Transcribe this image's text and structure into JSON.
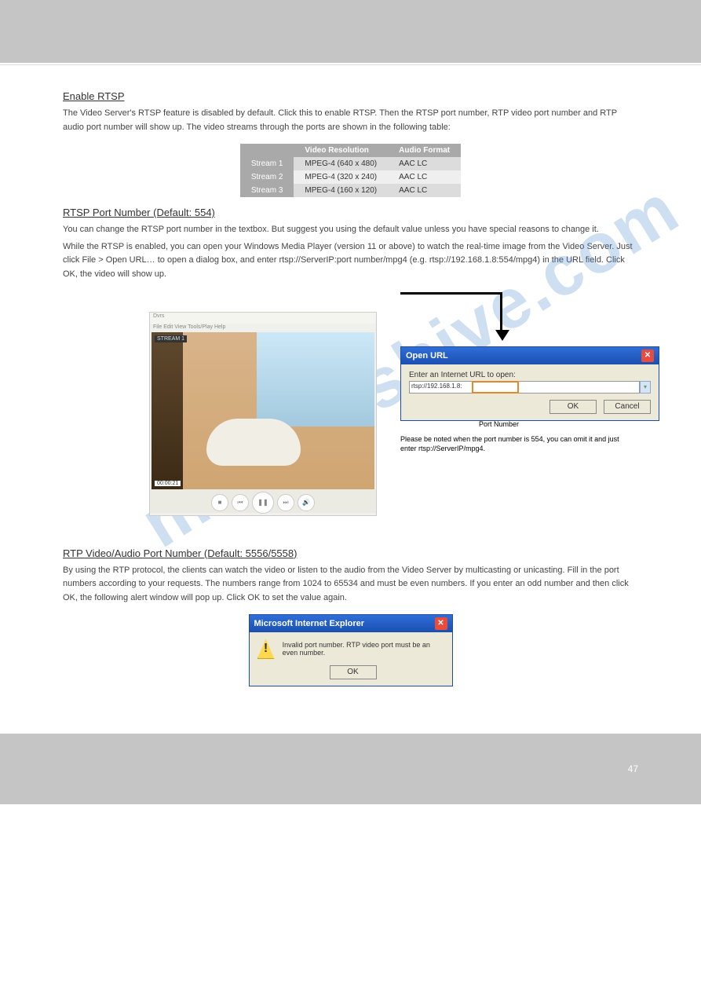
{
  "header": {
    "title": ""
  },
  "section1": {
    "title": "Enable RTSP",
    "para1": "The Video Server's RTSP feature is disabled by default. Click this to enable RTSP. Then the RTSP port number, RTP video port number and RTP audio port number will show up. The video streams through the ports are shown in the following table:",
    "table": {
      "head": [
        "",
        "Video Resolution",
        "Audio Format"
      ],
      "rows": [
        [
          "Stream 1",
          "MPEG-4 (640 x 480)",
          "AAC LC"
        ],
        [
          "Stream 2",
          "MPEG-4 (320 x 240)",
          "AAC LC"
        ],
        [
          "Stream 3",
          "MPEG-4 (160 x 120)",
          "AAC LC"
        ]
      ]
    }
  },
  "section2": {
    "title": "RTSP Port Number (Default: 554)",
    "para1": "You can change the RTSP port number in the textbox. But suggest you using the default value unless you have special reasons to change it.",
    "para2": "While the RTSP is enabled, you can open your Windows Media Player (version 11 or above) to watch the real-time image from the Video Server. Just click File > Open URL… to open a dialog box, and enter rtsp://ServerIP:port number/mpg4 (e.g. rtsp://192.168.1.8:554/mpg4) in the URL field. Click OK, the video will show up.",
    "wmp": {
      "menu": "File  Edit  View  Tools/Play  Help",
      "timestamp": "00:00:21",
      "streamname": "STREAM 1"
    },
    "url_dialog": {
      "title": "Open URL",
      "label": "Enter an Internet URL to open:",
      "prefix": "rtsp://192.168.1.8:",
      "ok": "OK",
      "cancel": "Cancel"
    },
    "annot_port": "Port Number",
    "annot_omit": "Please be noted when the port number is 554, you can omit it and just enter rtsp://ServerIP/mpg4."
  },
  "section3": {
    "title": "RTP Video/Audio Port Number (Default: 5556/5558)",
    "para1": "By using the RTP protocol, the clients can watch the video or listen to the audio from the Video Server by multicasting or unicasting. Fill in the port numbers according to your requests. The numbers range from 1024 to 65534 and must be even numbers. If you enter an odd number and then click OK, the following alert window will pop up. Click OK to set the value again."
  },
  "error_dialog": {
    "title": "Microsoft Internet Explorer",
    "msg": "Invalid port number. RTP video port must be an even number.",
    "ok": "OK"
  },
  "footer": {
    "page": "47"
  },
  "watermark": "manualshive.com"
}
